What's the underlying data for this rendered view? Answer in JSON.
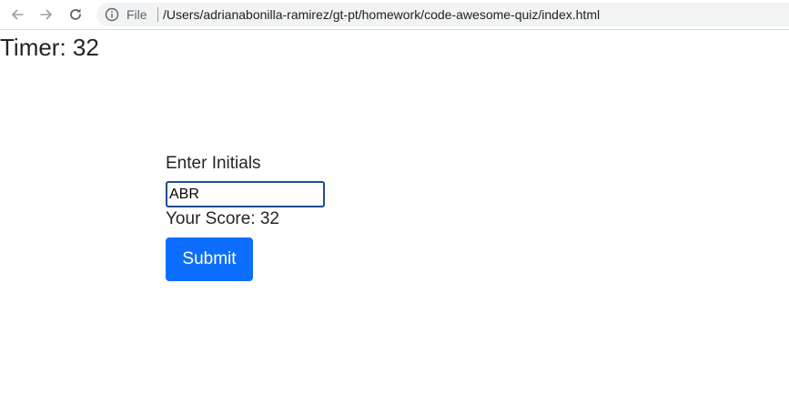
{
  "browser": {
    "scheme_label": "File",
    "url": "/Users/adrianabonilla-ramirez/gt-pt/homework/code-awesome-quiz/index.html",
    "icons": {
      "back": "arrow-left-icon",
      "forward": "arrow-right-icon",
      "reload": "reload-icon",
      "info": "info-icon"
    }
  },
  "page": {
    "timer": "Timer: 32",
    "initials_label": "Enter Initials",
    "initials_value": "ABR",
    "score": "Your Score: 32",
    "submit_label": "Submit"
  },
  "colors": {
    "accent": "#0d6efd",
    "input_border": "#1a4d8f",
    "omnibox_bg": "#f1f3f4"
  }
}
